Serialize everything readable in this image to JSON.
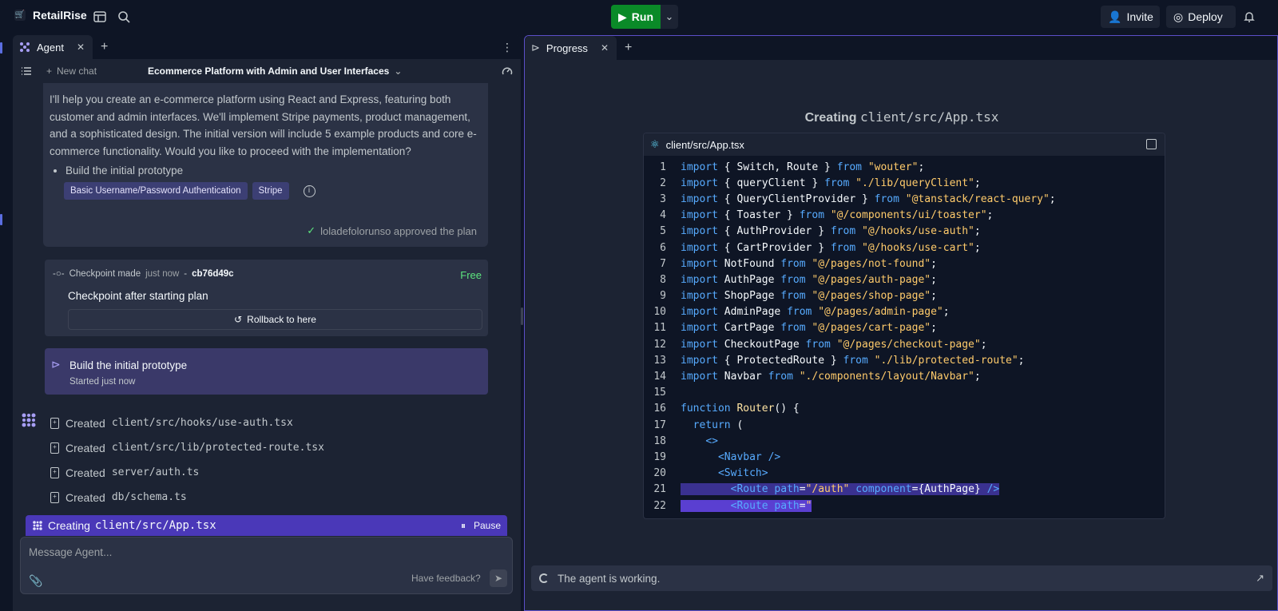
{
  "topbar": {
    "app_name": "RetailRise",
    "run_label": "Run",
    "invite_label": "Invite",
    "deploy_label": "Deploy"
  },
  "left": {
    "tab_label": "Agent",
    "new_chat": "New chat",
    "chat_title": "Ecommerce Platform with Admin and User Interfaces",
    "message": "I'll help you create an e-commerce platform using React and Express, featuring both customer and admin interfaces. We'll implement Stripe payments, product management, and a sophisticated design. The initial version will include 5 example products and core e-commerce functionality. Would you like to proceed with the implementation?",
    "bullet": "Build the initial prototype",
    "tags": [
      "Basic Username/Password Authentication",
      "Stripe"
    ],
    "approved": "loladefolorunso approved the plan",
    "checkpoint": {
      "label": "Checkpoint made",
      "when": "just now",
      "hash": "cb76d49c",
      "price": "Free",
      "title": "Checkpoint after starting plan",
      "rollback": "Rollback to here"
    },
    "build": {
      "title": "Build the initial prototype",
      "sub": "Started just now"
    },
    "files": [
      {
        "verb": "Created",
        "path": "client/src/hooks/use-auth.tsx"
      },
      {
        "verb": "Created",
        "path": "client/src/lib/protected-route.tsx"
      },
      {
        "verb": "Created",
        "path": "server/auth.ts"
      },
      {
        "verb": "Created",
        "path": "db/schema.ts"
      }
    ],
    "creating": {
      "verb": "Creating",
      "path": "client/src/App.tsx",
      "pause": "Pause"
    },
    "composer": {
      "placeholder": "Message Agent...",
      "feedback": "Have feedback?"
    }
  },
  "right": {
    "tab_label": "Progress",
    "title_verb": "Creating",
    "title_path": "client/src/App.tsx",
    "file_name": "client/src/App.tsx",
    "working": "The agent is working.",
    "code": [
      "import { Switch, Route } from \"wouter\";",
      "import { queryClient } from \"./lib/queryClient\";",
      "import { QueryClientProvider } from \"@tanstack/react-query\";",
      "import { Toaster } from \"@/components/ui/toaster\";",
      "import { AuthProvider } from \"@/hooks/use-auth\";",
      "import { CartProvider } from \"@/hooks/use-cart\";",
      "import NotFound from \"@/pages/not-found\";",
      "import AuthPage from \"@/pages/auth-page\";",
      "import ShopPage from \"@/pages/shop-page\";",
      "import AdminPage from \"@/pages/admin-page\";",
      "import CartPage from \"@/pages/cart-page\";",
      "import CheckoutPage from \"@/pages/checkout-page\";",
      "import { ProtectedRoute } from \"./lib/protected-route\";",
      "import Navbar from \"./components/layout/Navbar\";",
      "",
      "function Router() {",
      "  return (",
      "    <>",
      "      <Navbar />",
      "      <Switch>",
      "        <Route path=\"/auth\" component={AuthPage} />",
      "        <Route path=\""
    ]
  },
  "colors": {
    "accent": "#5b4fc9",
    "run_green": "#0a8a28",
    "free_green": "#5ce57e"
  }
}
